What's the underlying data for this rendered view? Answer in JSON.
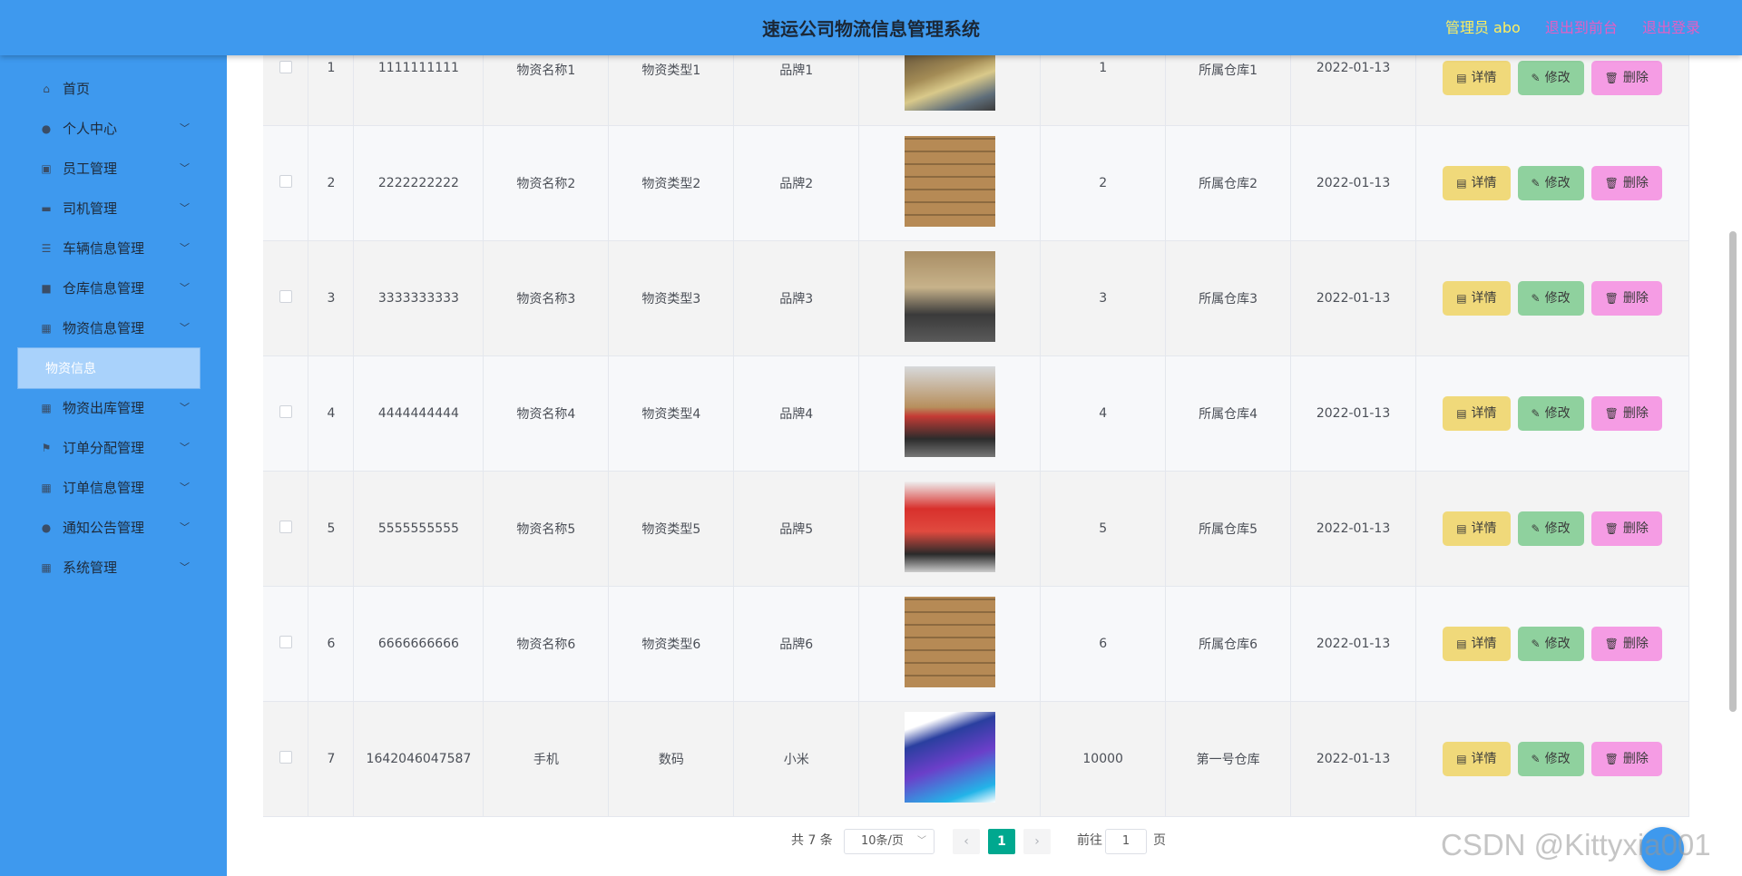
{
  "header": {
    "title": "速运公司物流信息管理系统",
    "admin_label": "管理员 abo",
    "back_to_front": "退出到前台",
    "logout": "退出登录"
  },
  "sidebar": {
    "items": [
      {
        "label": "首页",
        "icon": "home-icon",
        "expandable": false
      },
      {
        "label": "个人中心",
        "icon": "user-icon",
        "expandable": true
      },
      {
        "label": "员工管理",
        "icon": "form-icon",
        "expandable": true
      },
      {
        "label": "司机管理",
        "icon": "briefcase-icon",
        "expandable": true
      },
      {
        "label": "车辆信息管理",
        "icon": "list-icon",
        "expandable": true
      },
      {
        "label": "仓库信息管理",
        "icon": "box-icon",
        "expandable": true
      },
      {
        "label": "物资信息管理",
        "icon": "grid-icon",
        "expandable": true
      },
      {
        "label": "物资出库管理",
        "icon": "grid-icon",
        "expandable": true
      },
      {
        "label": "订单分配管理",
        "icon": "flag-icon",
        "expandable": true
      },
      {
        "label": "订单信息管理",
        "icon": "grid-icon",
        "expandable": true
      },
      {
        "label": "通知公告管理",
        "icon": "user-icon",
        "expandable": true
      },
      {
        "label": "系统管理",
        "icon": "grid-icon",
        "expandable": true
      }
    ],
    "active_sub": "物资信息"
  },
  "table": {
    "rows": [
      {
        "index": "1",
        "code": "1111111111",
        "name": "物资名称1",
        "type": "物资类型1",
        "brand": "品牌1",
        "image": "warehouse-photo",
        "qty": "1",
        "warehouse": "所属仓库1",
        "date": "2022-01-13"
      },
      {
        "index": "2",
        "code": "2222222222",
        "name": "物资名称2",
        "type": "物资类型2",
        "brand": "品牌2",
        "image": "boxes-photo",
        "qty": "2",
        "warehouse": "所属仓库2",
        "date": "2022-01-13"
      },
      {
        "index": "3",
        "code": "3333333333",
        "name": "物资名称3",
        "type": "物资类型3",
        "brand": "品牌3",
        "image": "ceremony-photo",
        "qty": "3",
        "warehouse": "所属仓库3",
        "date": "2022-01-13"
      },
      {
        "index": "4",
        "code": "4444444444",
        "name": "物资名称4",
        "type": "物资类型4",
        "brand": "品牌4",
        "image": "donation-photo",
        "qty": "4",
        "warehouse": "所属仓库4",
        "date": "2022-01-13"
      },
      {
        "index": "5",
        "code": "5555555555",
        "name": "物资名称5",
        "type": "物资类型5",
        "brand": "品牌5",
        "image": "banner-photo",
        "qty": "5",
        "warehouse": "所属仓库5",
        "date": "2022-01-13"
      },
      {
        "index": "6",
        "code": "6666666666",
        "name": "物资名称6",
        "type": "物资类型6",
        "brand": "品牌6",
        "image": "boxes-photo",
        "qty": "6",
        "warehouse": "所属仓库6",
        "date": "2022-01-13"
      },
      {
        "index": "7",
        "code": "1642046047587",
        "name": "手机",
        "type": "数码",
        "brand": "小米",
        "image": "phone-photo",
        "qty": "10000",
        "warehouse": "第一号仓库",
        "date": "2022-01-13"
      }
    ],
    "actions": {
      "detail": "详情",
      "edit": "修改",
      "delete": "删除"
    }
  },
  "pagination": {
    "total": "共 7 条",
    "page_size": "10条/页",
    "current_page": "1",
    "goto_prefix": "前往",
    "goto_value": "1",
    "goto_suffix": "页"
  },
  "watermark": "CSDN @Kittyxia001",
  "colors": {
    "header_bg": "#3e99ee",
    "sidebar_bg": "#3e99ee",
    "admin_text": "#ffef5e",
    "link_text": "#e55ec4",
    "page_active": "#00a88f",
    "detail_btn": "#f0d97a",
    "edit_btn": "#8fd19e",
    "delete_btn": "#f59ce4"
  }
}
